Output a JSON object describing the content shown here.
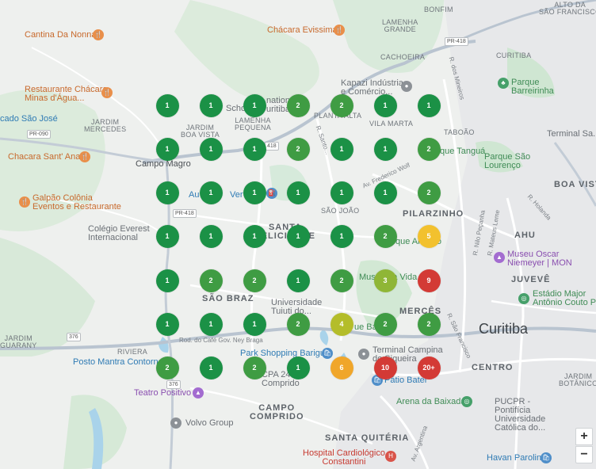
{
  "labels": {
    "bonfim": "BONFIM",
    "alto_sao_francisco": "ALTO DA\nSÃO FRANCISCO",
    "lamenha_grande": "LAMENHA\nGRANDE",
    "cantina_nonna": "Cantina Da Nonna",
    "chacara_evissima": "Chácara Evissima",
    "pr418": "PR-418",
    "cachoeira": "CACHOEIRA",
    "curitiba_n": "CURITIBA",
    "parque_barreirinha": "Parque\nBarreirinha",
    "restaurante_chacara": "Restaurante Chácara\nMinas d'Água...",
    "kapazi": "Kapazi Indústria\ne Comércio...",
    "sao_jose": "cado São José",
    "jardim_mercedes": "JARDIM\nMERCEDES",
    "national": "national\nuritiba",
    "schoo": "Schoo",
    "plant_alta": "PLANTA ALTA",
    "vila_marta": "VILA MARTA",
    "taboao": "TABOÃO",
    "terminal_santa": "Terminal Sa...",
    "pr090": "PR-090",
    "jardim_boa_vista": "JARDIM\nBOA VISTA",
    "lamenha_pequena": "LAMENHA\nPEQUENA",
    "chacara_santana": "Chacara Sant' Ana",
    "campo_magro": "Campo Magro",
    "parque_tangua": "que Tanguá",
    "parque_sao_lourenco": "Parque São\nLourenço",
    "boa_vista": "BOA VISTA",
    "galpao_colonia": "Galpão Colônia\nEventos e Restaurante",
    "pr418b": "PR-418",
    "sao_joao": "SÃO JOÃO",
    "pilarzinho": "PILARZINHO",
    "colegio_everest": "Colégio Everest\nInternacional",
    "santa_felicidade": "SANTA\nFELICIDADE",
    "bosque_alemao": "Bosque Alemão",
    "ahu": "AHU",
    "museu_oscar": "Museu Oscar\nNiemeyer | MON",
    "museu_vida": "Museu da Vida",
    "juveve": "JUVEVÊ",
    "estadio": "Estádio Major\nAntônio Couto Pe...",
    "sao_braz": "SÃO BRAZ",
    "universidade": "Universidade\nTuiuti do...",
    "merces": "MERCÊS",
    "curitiba": "Curitiba",
    "jardim_guarany": "JARDIM\nGUARANY",
    "riviera": "RIVIERA",
    "rod_cafe": "Rod. do Café Gov. Ney Braga",
    "park_shopping": "Park Shopping Barigui",
    "terminal_campina": "Terminal Campina\ndo Siqueira",
    "posto_mantra": "Posto Mantra Contorno",
    "centro": "CENTRO",
    "jardim_botanico": "JARDIM\nBOTÂNICO",
    "patio_batel": "Pátio Batel",
    "cpa24": "CPA 24\nComprido",
    "teatro_positivo": "Teatro Positivo",
    "arena_baixada": "Arena da Baixada",
    "pucpr": "PUCPR -\nPontifícia\nUniversidade\nCatólica do...",
    "campo_comprido": "CAMPO\nCOMPRIDO",
    "volvo": "Volvo Group",
    "santa_quiteria": "SANTA QUITÉRIA",
    "hospital": "Hospital Cardiológico\nConstantini",
    "havan": "Havan Parolin",
    "r_holanda": "R. Holanda",
    "r_nilo": "R. Nilo Peçanha",
    "r_mateus": "R. Mateus Leme",
    "r_frederico": "Av. Frederico Wolf",
    "r_santo": "R. Santo...",
    "r_dos_mineiros": "R. dos Mineiros",
    "br376": "376",
    "r_brasilio": "R. Brasílio...",
    "av_argentina": "Av. Argentina",
    "r_rio_branco": "R. São Francisco"
  },
  "clusters": [
    {
      "count": "1",
      "status": "green"
    },
    {
      "count": "1",
      "status": "green"
    },
    {
      "count": "1",
      "status": "green"
    },
    {
      "count": "2",
      "status": "green2"
    },
    {
      "count": "2",
      "status": "green2"
    },
    {
      "count": "1",
      "status": "green"
    },
    {
      "count": "1",
      "status": "green"
    },
    {
      "count": "1",
      "status": "green"
    },
    {
      "count": "1",
      "status": "green"
    },
    {
      "count": "1",
      "status": "green"
    },
    {
      "count": "2",
      "status": "green2"
    },
    {
      "count": "1",
      "status": "green"
    },
    {
      "count": "1",
      "status": "green"
    },
    {
      "count": "2",
      "status": "green2"
    },
    {
      "count": "1",
      "status": "green"
    },
    {
      "count": "1",
      "status": "green"
    },
    {
      "count": "1",
      "status": "green"
    },
    {
      "count": "1",
      "status": "green"
    },
    {
      "count": "1",
      "status": "green"
    },
    {
      "count": "1",
      "status": "green"
    },
    {
      "count": "2",
      "status": "green2"
    },
    {
      "count": "1",
      "status": "green"
    },
    {
      "count": "1",
      "status": "green"
    },
    {
      "count": "1",
      "status": "green"
    },
    {
      "count": "1",
      "status": "green"
    },
    {
      "count": "1",
      "status": "green"
    },
    {
      "count": "2",
      "status": "green2"
    },
    {
      "count": "5",
      "status": "yellow"
    },
    {
      "count": "1",
      "status": "green"
    },
    {
      "count": "2",
      "status": "green2"
    },
    {
      "count": "2",
      "status": "green2"
    },
    {
      "count": "1",
      "status": "green"
    },
    {
      "count": "2",
      "status": "green2"
    },
    {
      "count": "3",
      "status": "olive"
    },
    {
      "count": "9",
      "status": "red"
    },
    {
      "count": "1",
      "status": "green"
    },
    {
      "count": "1",
      "status": "green"
    },
    {
      "count": "1",
      "status": "green"
    },
    {
      "count": "2",
      "status": "green2"
    },
    {
      "count": "4",
      "status": "olive2"
    },
    {
      "count": "2",
      "status": "green2"
    },
    {
      "count": "2",
      "status": "green2"
    },
    {
      "count": "2",
      "status": "green2"
    },
    {
      "count": "1",
      "status": "green"
    },
    {
      "count": "2",
      "status": "green2"
    },
    {
      "count": "1",
      "status": "green"
    },
    {
      "count": "6",
      "status": "orange"
    },
    {
      "count": "10",
      "status": "red"
    },
    {
      "count": "20+",
      "status": "red"
    }
  ],
  "colors": {
    "green": "#1b9146",
    "green2": "#3f9c43",
    "olive": "#8fb636",
    "olive2": "#b4bd2a",
    "yellow": "#f2c12e",
    "orange": "#f0a62a",
    "red": "#d33a35"
  },
  "zoom": {
    "in": "+",
    "out": "−"
  }
}
